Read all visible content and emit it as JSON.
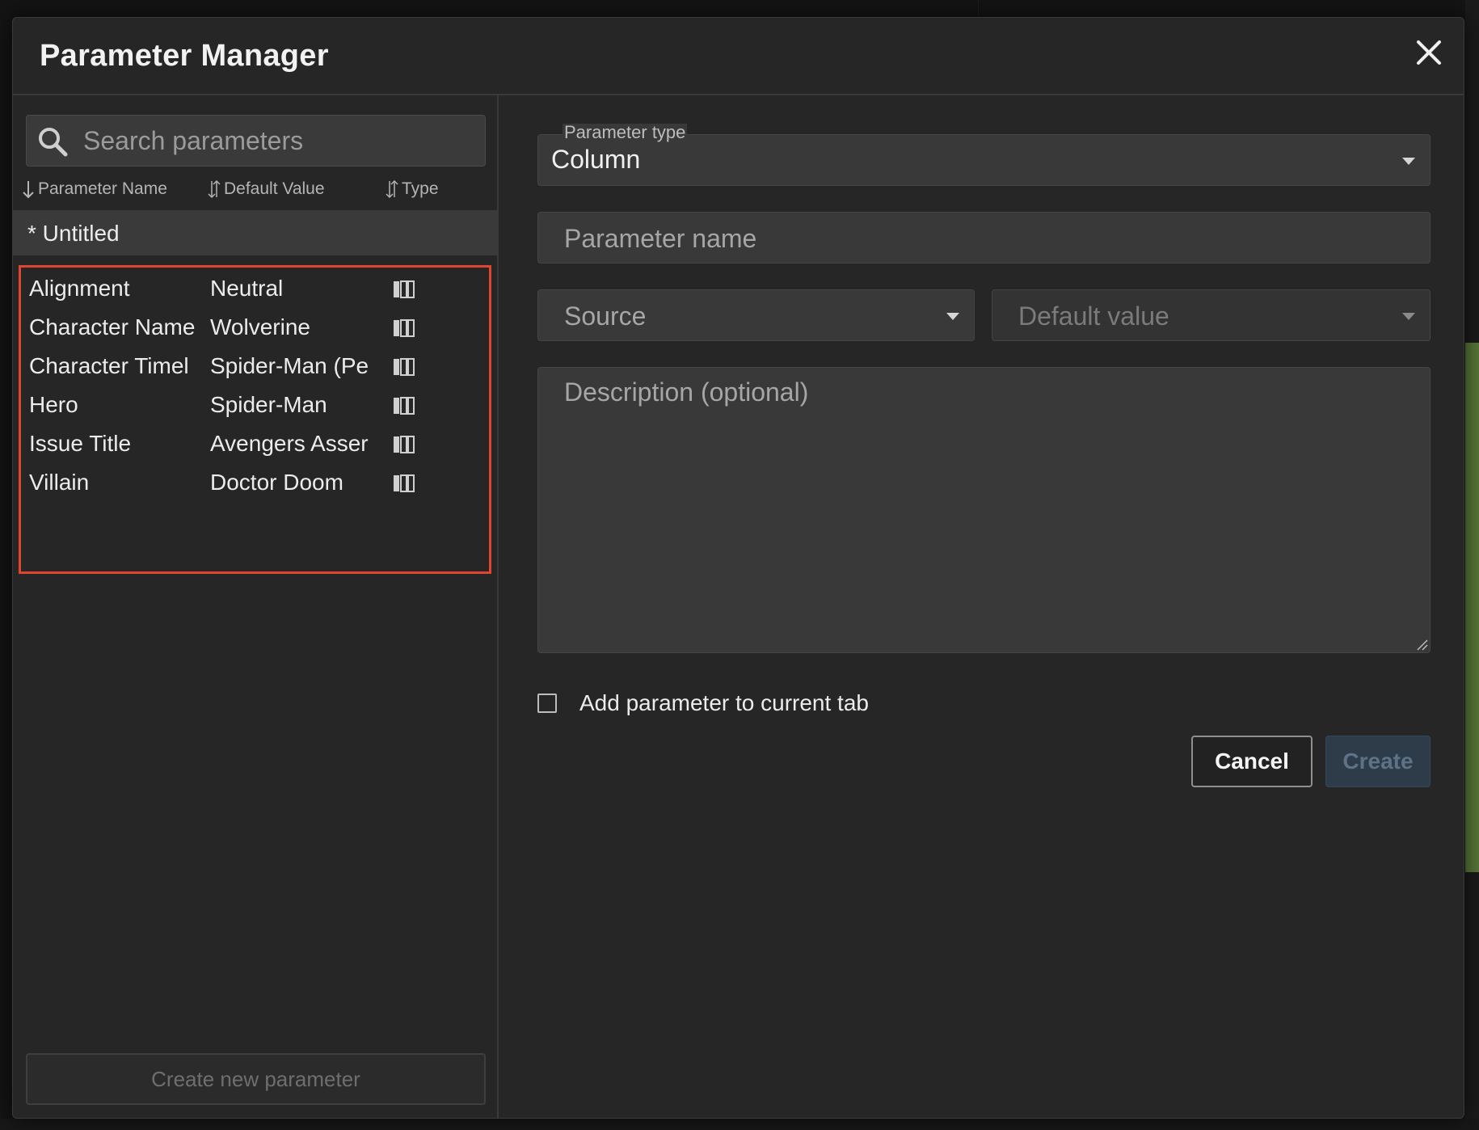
{
  "dialog": {
    "title": "Parameter Manager"
  },
  "search": {
    "placeholder": "Search parameters"
  },
  "columns": {
    "name": "Parameter Name",
    "default": "Default Value",
    "type": "Type"
  },
  "untitled_label": "* Untitled",
  "parameters": [
    {
      "name": "Alignment",
      "default": "Neutral",
      "type_icon": "column-icon"
    },
    {
      "name": "Character Name",
      "default": "Wolverine",
      "type_icon": "column-icon"
    },
    {
      "name": "Character Timel",
      "default": "Spider-Man (Pe",
      "type_icon": "column-icon"
    },
    {
      "name": "Hero",
      "default": "Spider-Man",
      "type_icon": "column-icon"
    },
    {
      "name": "Issue Title",
      "default": "Avengers Asser",
      "type_icon": "column-icon"
    },
    {
      "name": "Villain",
      "default": "Doctor Doom",
      "type_icon": "column-icon"
    }
  ],
  "create_new_label": "Create new parameter",
  "form": {
    "type_label": "Parameter type",
    "type_value": "Column",
    "name_placeholder": "Parameter name",
    "source_placeholder": "Source",
    "default_placeholder": "Default value",
    "description_placeholder": "Description (optional)",
    "add_to_tab_label": "Add parameter to current tab",
    "cancel_label": "Cancel",
    "create_label": "Create"
  },
  "colors": {
    "highlight_border": "#e0452f",
    "dialog_bg": "#262626",
    "field_bg": "#393939"
  }
}
